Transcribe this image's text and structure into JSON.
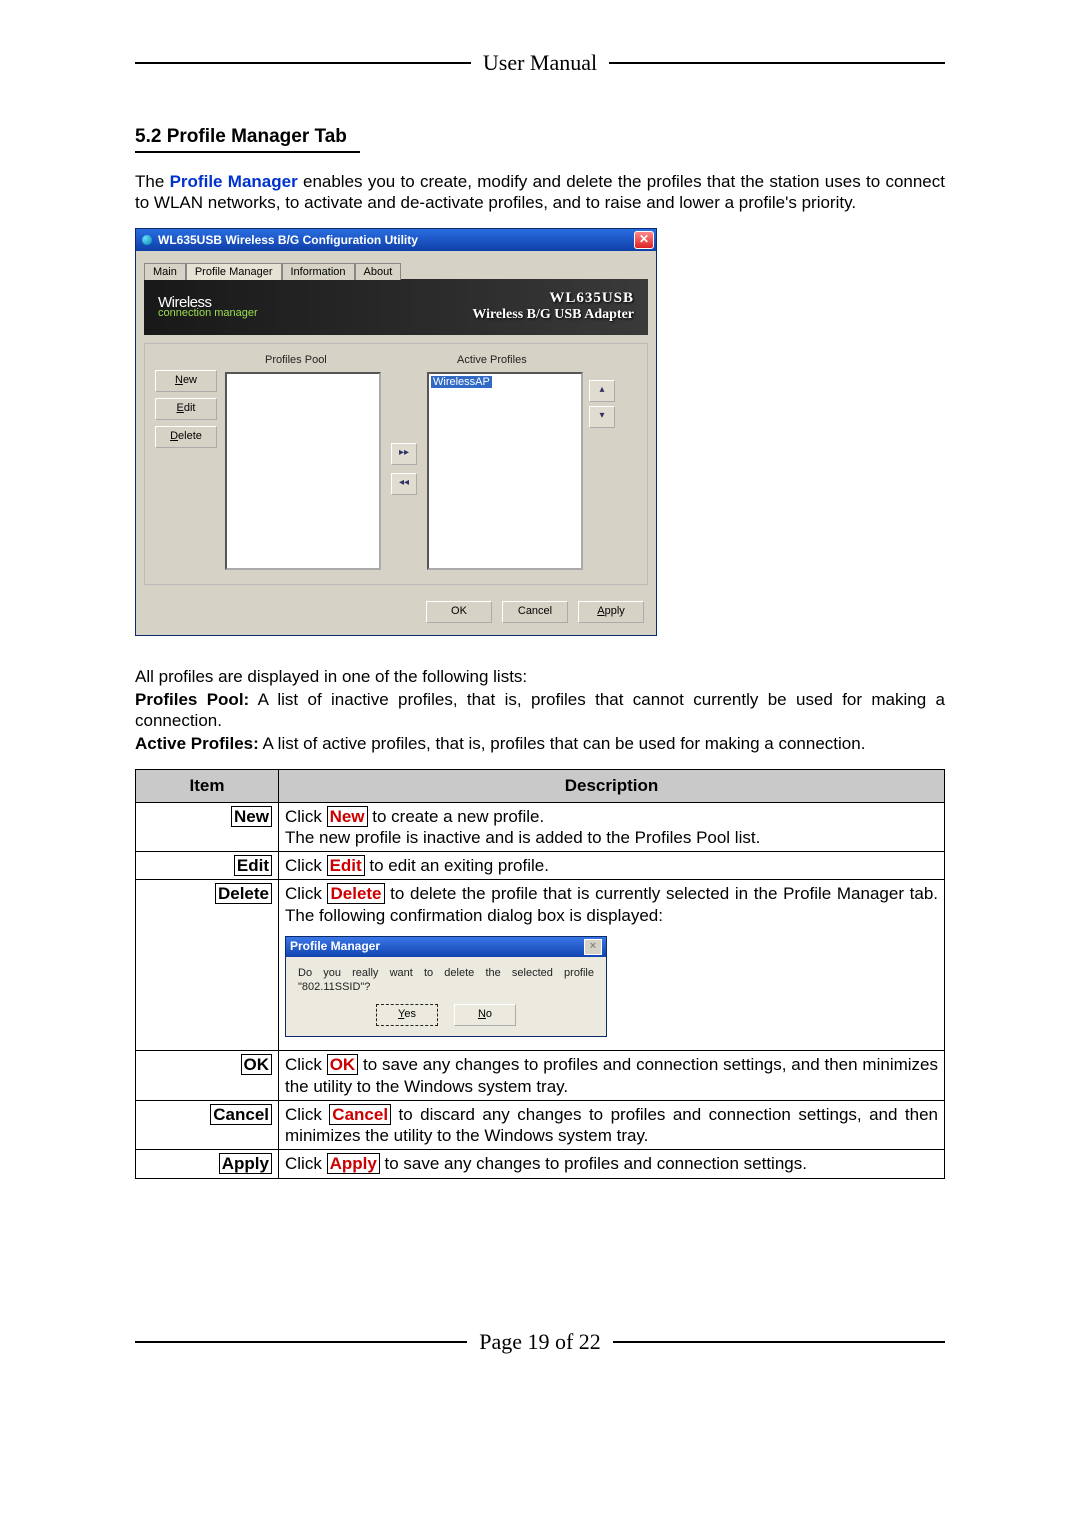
{
  "header": {
    "label": "User Manual"
  },
  "section": {
    "number_title": "5.2 Profile Manager Tab"
  },
  "intro": {
    "prefix": "The ",
    "blue": "Profile Manager",
    "rest": " enables you to create, modify and delete the profiles that the station uses to connect to WLAN networks, to activate and de-activate profiles, and to raise and lower a profile's priority."
  },
  "win": {
    "title": "WL635USB Wireless B/G Configuration Utility",
    "close": "✕",
    "tabs": {
      "main": "Main",
      "pm": "Profile Manager",
      "info": "Information",
      "about": "About"
    },
    "banner": {
      "wl": "Wireless",
      "cm": "connection manager",
      "r1": "WL635USB",
      "r2": "Wireless B/G USB Adapter"
    },
    "cols": {
      "pool": "Profiles Pool",
      "active": "Active Profiles"
    },
    "active_item": "WirelessAP",
    "btns": {
      "new_u": "N",
      "new_r": "ew",
      "edit_u": "E",
      "edit_r": "dit",
      "del_u": "D",
      "del_r": "elete"
    },
    "arrows": {
      "right": "▸▸",
      "left": "◂◂",
      "up": "▴",
      "down": "▾"
    },
    "footer": {
      "ok": "OK",
      "cancel": "Cancel",
      "apply_u": "A",
      "apply_r": "pply"
    }
  },
  "lists_intro": "All profiles are displayed in one of the following lists:",
  "profiles_pool_label": "Profiles Pool:",
  "profiles_pool_text": " A list of inactive profiles, that is, profiles that cannot currently be used for making a connection.",
  "active_profiles_label": "Active Profiles:",
  "active_profiles_text": " A list of active profiles, that is, profiles that can be used for making a connection.",
  "table": {
    "head_item": "Item",
    "head_desc": "Description",
    "new": {
      "item": "New",
      "pre": "Click ",
      "btn": "New",
      "post": " to create a new profile.",
      "line2": "The new profile is inactive and is added to the Profiles Pool list."
    },
    "edit": {
      "item": "Edit",
      "pre": "Click ",
      "btn": "Edit",
      "post": " to edit an exiting profile."
    },
    "delete": {
      "item": "Delete",
      "pre": "Click ",
      "btn": "Delete",
      "post": " to delete the profile that is currently selected in the Profile Manager tab. The following confirmation dialog box is displayed:"
    },
    "ok": {
      "item": "OK",
      "pre": "Click ",
      "btn": "OK",
      "post": " to save any changes to profiles and connection settings, and then minimizes the utility to the Windows system tray."
    },
    "cancel": {
      "item": "Cancel",
      "pre": "Click ",
      "btn": "Cancel",
      "post": " to discard any changes to profiles and connection settings, and then minimizes the utility to the Windows system tray."
    },
    "apply": {
      "item": "Apply",
      "pre": "Click ",
      "btn": "Apply",
      "post": " to save any changes to profiles and connection settings."
    }
  },
  "mini": {
    "title": "Profile Manager",
    "msg": "Do you really want to delete the selected profile \"802.11SSID\"?",
    "yes_u": "Y",
    "yes_r": "es",
    "no_u": "N",
    "no_r": "o"
  },
  "footer": {
    "label": "Page 19 of 22"
  }
}
